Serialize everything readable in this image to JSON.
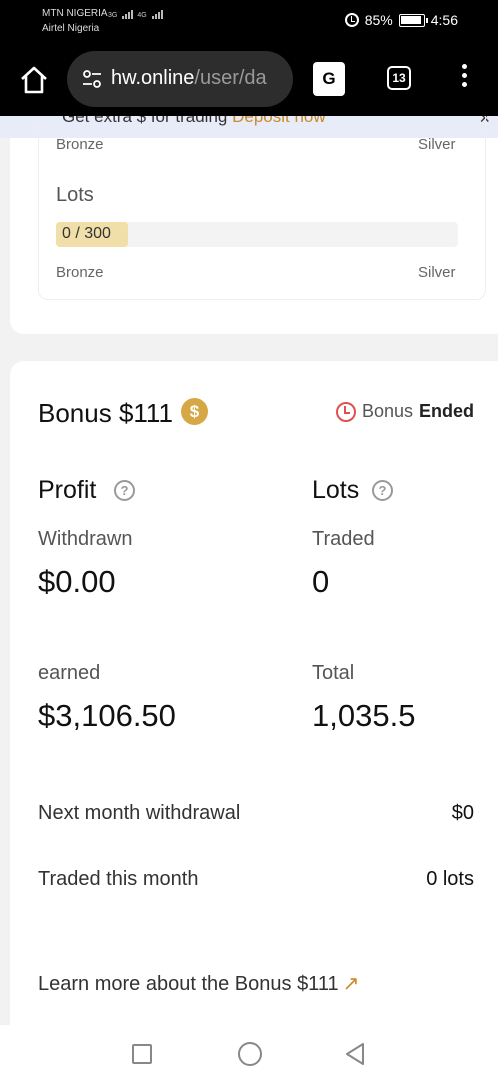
{
  "status_bar": {
    "carrier_1": "MTN NIGERIA",
    "carrier_2": "Airtel Nigeria",
    "signal_1_type": "3G",
    "signal_2_type": "4G",
    "battery": "85%",
    "time": "4:56",
    "icons": [
      "alarm-icon",
      "battery-icon"
    ]
  },
  "browser": {
    "url_host": "hw.online",
    "url_path": "/user/da",
    "translate_label": "G",
    "tab_count": "13"
  },
  "promo_banner": {
    "text": "Get extra $ for trading",
    "link": "Deposit now",
    "close": "×"
  },
  "tier_card": {
    "top_left": "Bronze",
    "top_right": "Silver",
    "lots_title": "Lots",
    "progress_label": "0 / 300",
    "progress_fraction": 0.0,
    "bottom_left": "Bronze",
    "bottom_right": "Silver"
  },
  "bonus": {
    "title": "Bonus $111",
    "status_prefix": "Bonus",
    "status_value": "Ended",
    "accent_color": "#d6a845",
    "profit": {
      "heading": "Profit",
      "withdrawn_label": "Withdrawn",
      "withdrawn_value": "$0.00",
      "earned_label": "earned",
      "earned_value": "$3,106.50"
    },
    "lots": {
      "heading": "Lots",
      "traded_label": "Traded",
      "traded_value": "0",
      "total_label": "Total",
      "total_value": "1,035.5"
    },
    "rows": [
      {
        "label": "Next month withdrawal",
        "value": "$0"
      },
      {
        "label": "Traded this month",
        "value": "0 lots"
      }
    ],
    "learn_more": "Learn more about the Bonus $111",
    "learn_more_arrow": "↗"
  },
  "nav_bar": {
    "icons": [
      "recents-square-icon",
      "home-circle-icon",
      "back-triangle-icon"
    ]
  }
}
